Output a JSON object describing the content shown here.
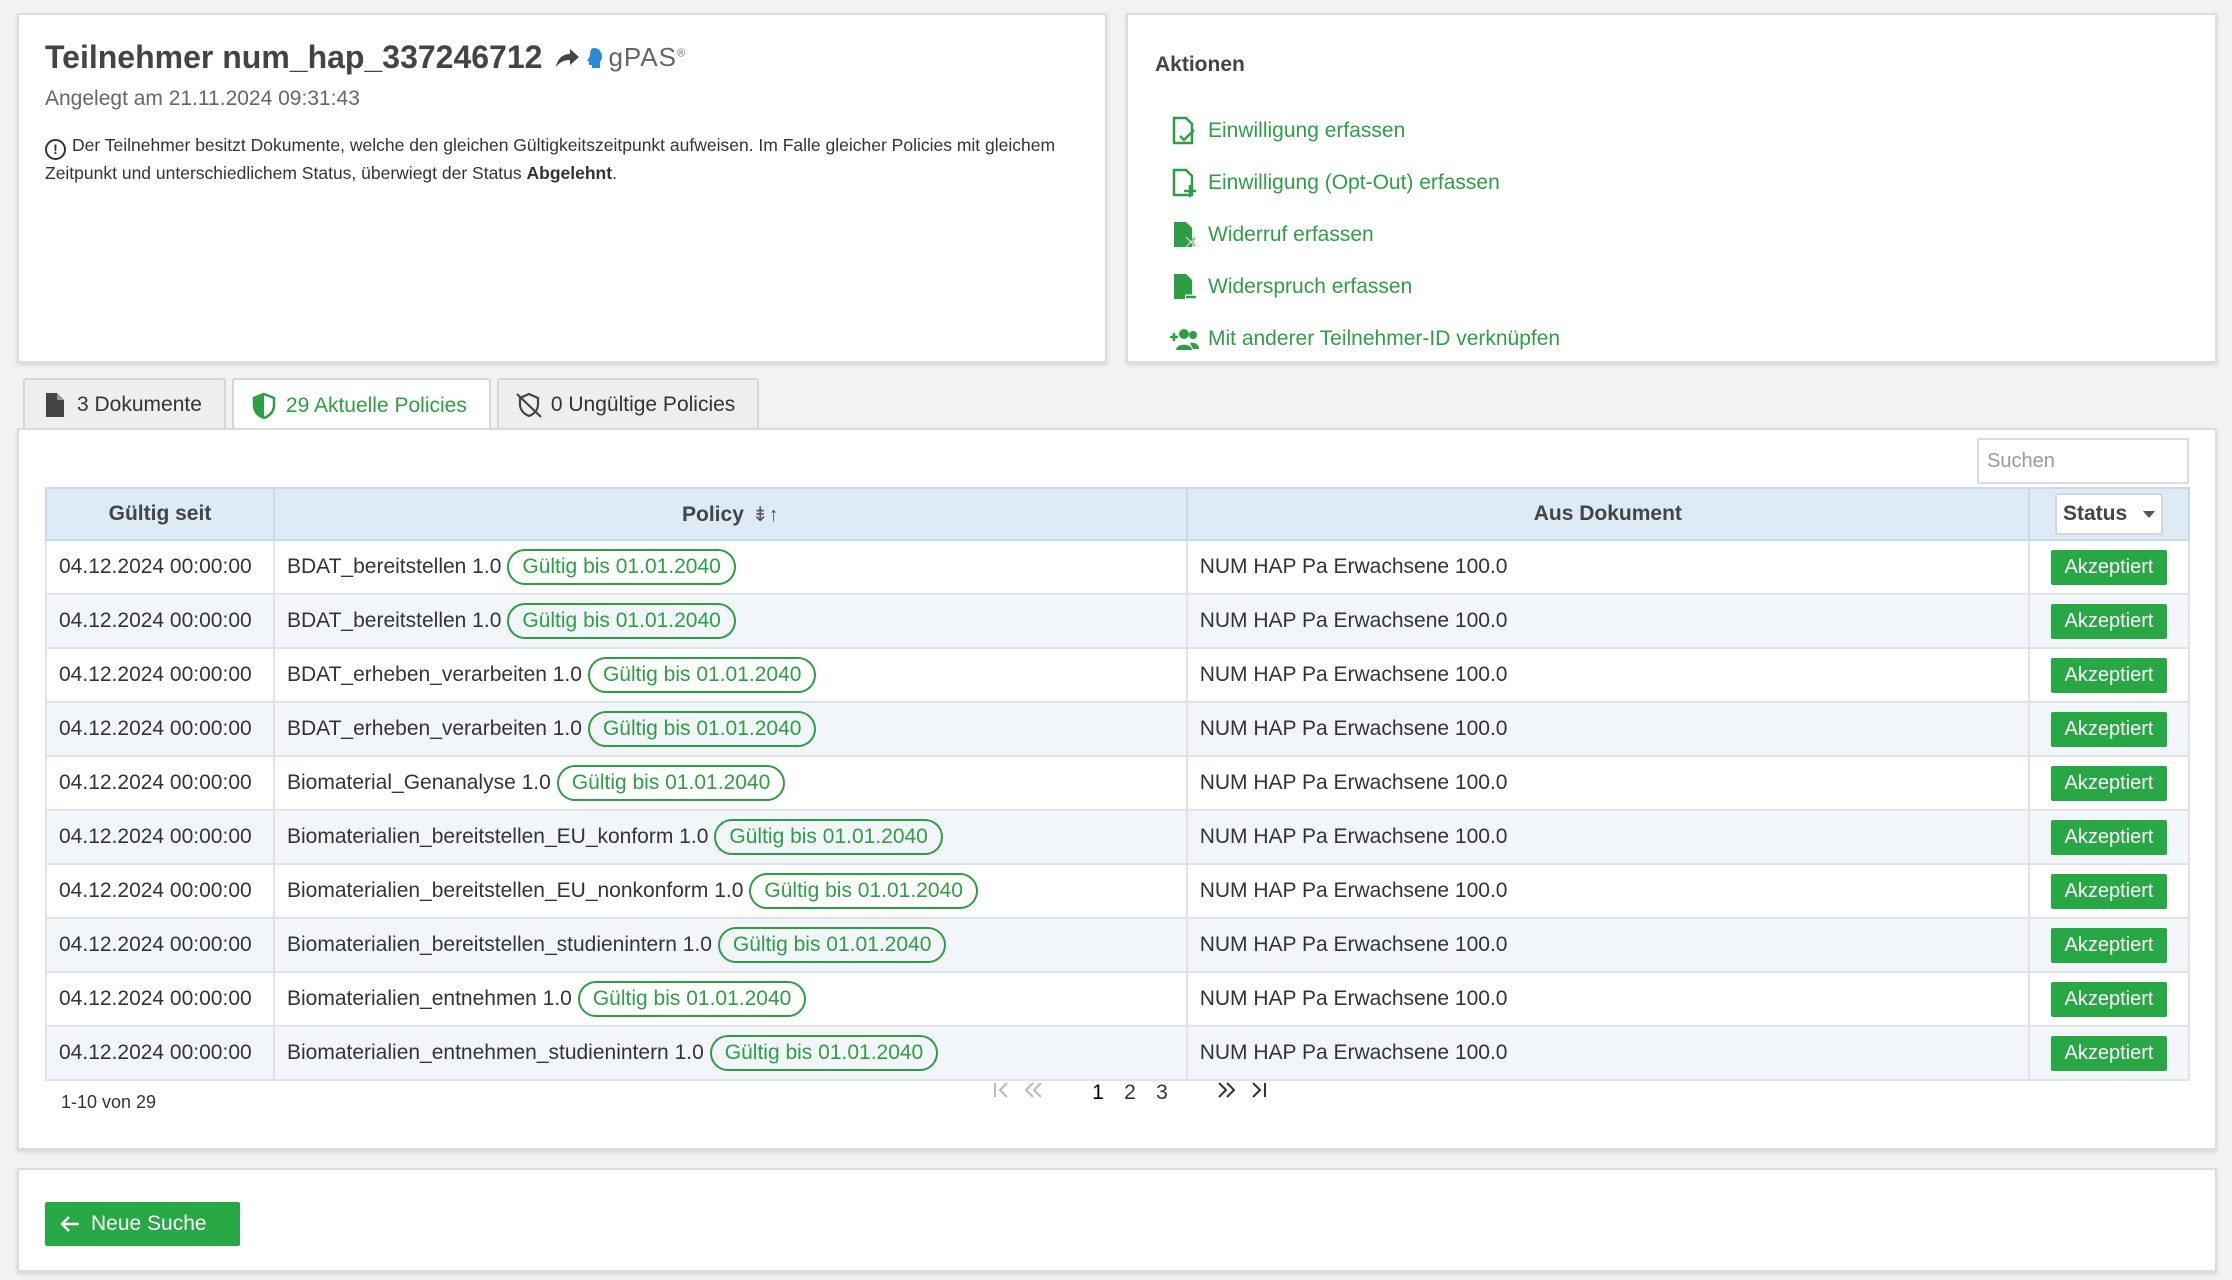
{
  "participant": {
    "title": "Teilnehmer num_hap_337246712",
    "gpas_label": "gPAS",
    "gpas_sup": "®",
    "created": "Angelegt am 21.11.2024 09:31:43",
    "notice_text": "Der Teilnehmer besitzt Dokumente, welche den gleichen Gültigkeitszeitpunkt aufweisen. Im Falle gleicher Policies mit gleichem Zeitpunkt und unterschiedlichem Status, überwiegt der Status ",
    "notice_bold": "Abgelehnt",
    "notice_end": "."
  },
  "actions": {
    "title": "Aktionen",
    "items": [
      {
        "label": "Einwilligung erfassen",
        "icon": "document-check-icon"
      },
      {
        "label": "Einwilligung (Opt-Out) erfassen",
        "icon": "document-plus-icon"
      },
      {
        "label": "Widerruf erfassen",
        "icon": "document-x-icon"
      },
      {
        "label": "Widerspruch erfassen",
        "icon": "document-minus-icon"
      },
      {
        "label": "Mit anderer Teilnehmer-ID verknüpfen",
        "icon": "users-plus-icon"
      }
    ]
  },
  "tabs": [
    {
      "label": "3 Dokumente",
      "icon": "file-icon",
      "active": false
    },
    {
      "label": "29 Aktuelle Policies",
      "icon": "shield-icon",
      "active": true
    },
    {
      "label": "0 Ungültige Policies",
      "icon": "shield-slash-icon",
      "active": false
    }
  ],
  "table": {
    "search_placeholder": "Suchen",
    "headers": {
      "valid_since": "Gültig seit",
      "policy": "Policy",
      "policy_sort": "⇟↑",
      "document": "Aus Dokument",
      "status": "Status"
    },
    "rows": [
      {
        "date": "04.12.2024 00:00:00",
        "policy": "BDAT_bereitstellen 1.0",
        "badge": "Gültig bis 01.01.2040",
        "document": "NUM HAP Pa Erwachsene 100.0",
        "status": "Akzeptiert"
      },
      {
        "date": "04.12.2024 00:00:00",
        "policy": "BDAT_bereitstellen 1.0",
        "badge": "Gültig bis 01.01.2040",
        "document": "NUM HAP Pa Erwachsene 100.0",
        "status": "Akzeptiert"
      },
      {
        "date": "04.12.2024 00:00:00",
        "policy": "BDAT_erheben_verarbeiten 1.0",
        "badge": "Gültig bis 01.01.2040",
        "document": "NUM HAP Pa Erwachsene 100.0",
        "status": "Akzeptiert"
      },
      {
        "date": "04.12.2024 00:00:00",
        "policy": "BDAT_erheben_verarbeiten 1.0",
        "badge": "Gültig bis 01.01.2040",
        "document": "NUM HAP Pa Erwachsene 100.0",
        "status": "Akzeptiert"
      },
      {
        "date": "04.12.2024 00:00:00",
        "policy": "Biomaterial_Genanalyse 1.0",
        "badge": "Gültig bis 01.01.2040",
        "document": "NUM HAP Pa Erwachsene 100.0",
        "status": "Akzeptiert"
      },
      {
        "date": "04.12.2024 00:00:00",
        "policy": "Biomaterialien_bereitstellen_EU_konform 1.0",
        "badge": "Gültig bis 01.01.2040",
        "document": "NUM HAP Pa Erwachsene 100.0",
        "status": "Akzeptiert"
      },
      {
        "date": "04.12.2024 00:00:00",
        "policy": "Biomaterialien_bereitstellen_EU_nonkonform 1.0",
        "badge": "Gültig bis 01.01.2040",
        "document": "NUM HAP Pa Erwachsene 100.0",
        "status": "Akzeptiert"
      },
      {
        "date": "04.12.2024 00:00:00",
        "policy": "Biomaterialien_bereitstellen_studienintern 1.0",
        "badge": "Gültig bis 01.01.2040",
        "document": "NUM HAP Pa Erwachsene 100.0",
        "status": "Akzeptiert"
      },
      {
        "date": "04.12.2024 00:00:00",
        "policy": "Biomaterialien_entnehmen 1.0",
        "badge": "Gültig bis 01.01.2040",
        "document": "NUM HAP Pa Erwachsene 100.0",
        "status": "Akzeptiert"
      },
      {
        "date": "04.12.2024 00:00:00",
        "policy": "Biomaterialien_entnehmen_studienintern 1.0",
        "badge": "Gültig bis 01.01.2040",
        "document": "NUM HAP Pa Erwachsene 100.0",
        "status": "Akzeptiert"
      }
    ],
    "range_text": "1-10 von 29",
    "pager": {
      "first": "I<",
      "prev": "«",
      "pages": [
        "1",
        "2",
        "3"
      ],
      "current_page": "1",
      "next": "»",
      "last": ">I"
    }
  },
  "bottom": {
    "new_search_label": "Neue Suche"
  },
  "colors": {
    "accent": "#2e9e44",
    "button": "#28a745",
    "header_bg": "#dcebf5"
  }
}
